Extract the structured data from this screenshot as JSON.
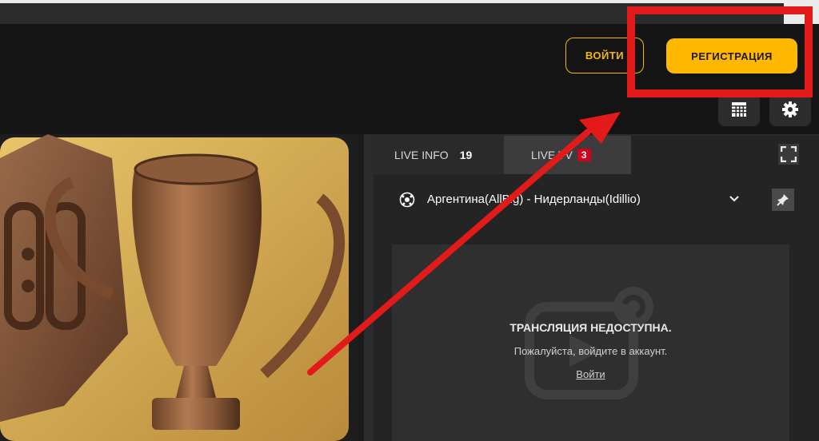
{
  "header": {
    "login_label": "ВОЙТИ",
    "register_label": "РЕГИСТРАЦИЯ",
    "calendar_icon": "calendar-icon",
    "settings_icon": "gear-icon"
  },
  "sidebar": {
    "tabs": [
      {
        "label": "LIVE INFO",
        "count": "19"
      },
      {
        "label": "LIVE TV",
        "badge": "3"
      }
    ],
    "match_title": "Аргентина(AllBig) - Нидерланды(Idillio)",
    "player": {
      "title": "ТРАНСЛЯЦИЯ НЕДОСТУПНА.",
      "message": "Пожалуйста, войдите в аккаунт.",
      "login_link": "Войти"
    }
  },
  "colors": {
    "accent": "#ffb800",
    "annotation_red": "#e31a1a",
    "live_badge": "#d0021b"
  }
}
